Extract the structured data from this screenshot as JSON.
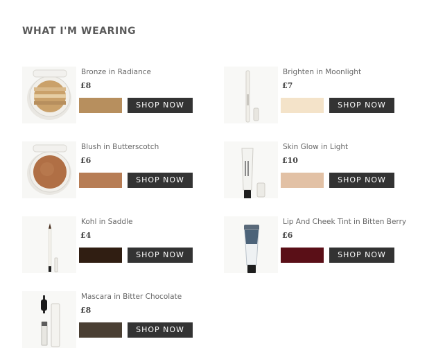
{
  "heading": "WHAT I'M WEARING",
  "products": [
    {
      "name": "Bronze in Radiance",
      "price": "£8",
      "swatch": "#b78f5e",
      "icon": "bronzer-compact-icon"
    },
    {
      "name": "Brighten in Moonlight",
      "price": "£7",
      "swatch": "#f4e3c9",
      "icon": "concealer-pen-icon"
    },
    {
      "name": "Blush in Butterscotch",
      "price": "£6",
      "swatch": "#b77d55",
      "icon": "blush-compact-icon"
    },
    {
      "name": "Skin Glow in Light",
      "price": "£10",
      "swatch": "#e2c1a5",
      "icon": "foundation-tube-icon"
    },
    {
      "name": "Kohl in Saddle",
      "price": "£4",
      "swatch": "#301e12",
      "icon": "kohl-pencil-icon"
    },
    {
      "name": "Lip And Cheek Tint in Bitten Berry",
      "price": "£6",
      "swatch": "#5a0f17",
      "icon": "tint-tube-icon"
    },
    {
      "name": "Mascara in Bitter Chocolate",
      "price": "£8",
      "swatch": "#4a3f33",
      "icon": "mascara-icon"
    }
  ],
  "shop_label": "SHOP NOW"
}
